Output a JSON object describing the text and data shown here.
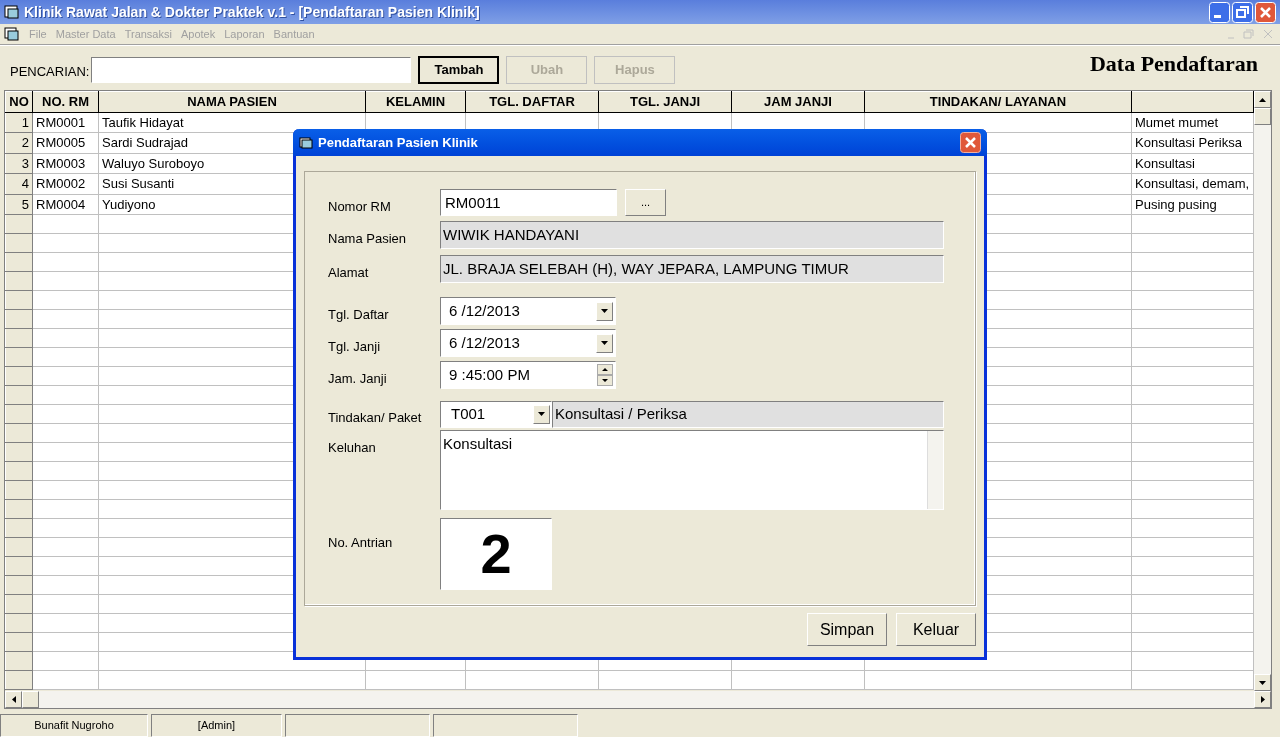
{
  "window": {
    "title": "Klinik Rawat Jalan & Dokter Praktek v.1 - [Pendaftaran Pasien Klinik]"
  },
  "menu": [
    "File",
    "Master Data",
    "Transaksi",
    "Apotek",
    "Laporan",
    "Bantuan"
  ],
  "toolbar": {
    "search_label": "PENCARIAN:",
    "buttons": [
      {
        "label": "Tambah",
        "disabled": false
      },
      {
        "label": "Ubah",
        "disabled": true
      },
      {
        "label": "Hapus",
        "disabled": true
      }
    ],
    "heading": "Data Pendaftaran"
  },
  "table": {
    "columns": [
      "NO",
      "NO. RM",
      "NAMA PASIEN",
      "KELAMIN",
      "TGL. DAFTAR",
      "TGL. JANJI",
      "JAM JANJI",
      "TINDAKAN/ LAYANAN",
      ""
    ],
    "rows": [
      {
        "no": "1",
        "rm": "RM0001",
        "nama": "Taufik Hidayat",
        "keluhan": "Mumet mumet"
      },
      {
        "no": "2",
        "rm": "RM0005",
        "nama": "Sardi Sudrajad",
        "keluhan": "Konsultasi Periksa"
      },
      {
        "no": "3",
        "rm": "RM0003",
        "nama": "Waluyo Suroboyo",
        "keluhan": "Konsultasi"
      },
      {
        "no": "4",
        "rm": "RM0002",
        "nama": "Susi Susanti",
        "keluhan": "Konsultasi, demam,"
      },
      {
        "no": "5",
        "rm": "RM0004",
        "nama": "Yudiyono",
        "keluhan": "Pusing pusing"
      }
    ]
  },
  "dialog": {
    "title": "Pendaftaran Pasien Klinik",
    "nomor_rm": {
      "label": "Nomor RM",
      "value": "RM0011",
      "button": "..."
    },
    "nama_pasien": {
      "label": "Nama Pasien",
      "value": "WIWIK HANDAYANI"
    },
    "alamat": {
      "label": "Alamat",
      "value": "JL. BRAJA SELEBAH (H), WAY JEPARA, LAMPUNG TIMUR"
    },
    "tgl_daftar": {
      "label": "Tgl. Daftar",
      "value": "6 /12/2013"
    },
    "tgl_janji": {
      "label": "Tgl. Janji",
      "value": "6 /12/2013"
    },
    "jam_janji": {
      "label": "Jam. Janji",
      "value": "9 :45:00 PM"
    },
    "tindakan": {
      "label": "Tindakan/ Paket",
      "code": "T001",
      "name": "Konsultasi / Periksa"
    },
    "keluhan": {
      "label": "Keluhan",
      "value": "Konsultasi"
    },
    "antrian": {
      "label": "No. Antrian",
      "value": "2"
    },
    "buttons": [
      "Simpan",
      "Keluar"
    ]
  },
  "status_bar": [
    "Bunafit Nugroho",
    "[Admin]"
  ]
}
